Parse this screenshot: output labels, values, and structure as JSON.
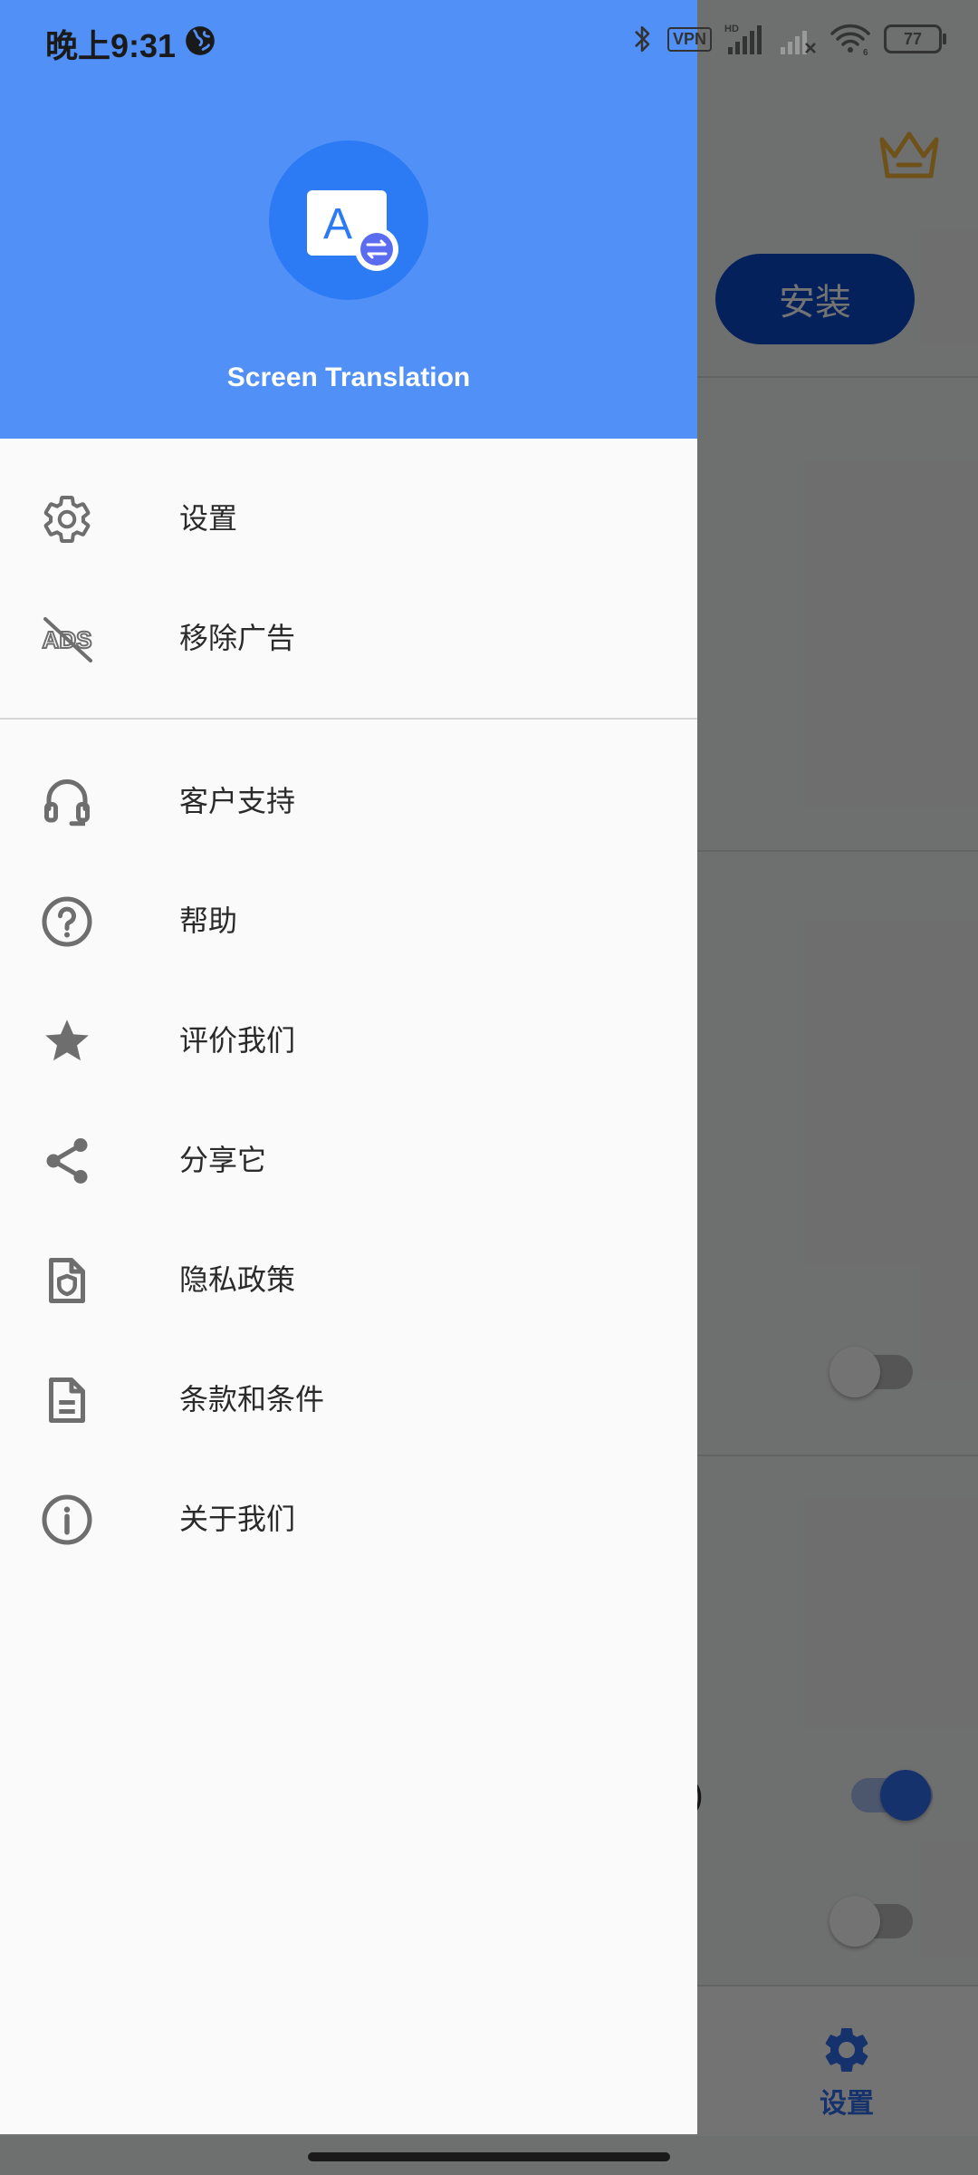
{
  "status_bar": {
    "time": "晚上9:31",
    "vpn": "VPN",
    "hd": "HD",
    "battery": "77",
    "wifi_sub": "6"
  },
  "drawer": {
    "app_name": "Screen Translation",
    "logo_letter": "A",
    "menu_primary": [
      {
        "label": "设置",
        "icon": "gear-icon"
      },
      {
        "label": "移除广告",
        "icon": "ads-off-icon"
      }
    ],
    "menu_secondary": [
      {
        "label": "客户支持",
        "icon": "headset-icon"
      },
      {
        "label": "帮助",
        "icon": "help-circle-icon"
      },
      {
        "label": "评价我们",
        "icon": "star-icon"
      },
      {
        "label": "分享它",
        "icon": "share-icon"
      },
      {
        "label": "隐私政策",
        "icon": "privacy-doc-icon"
      },
      {
        "label": "条款和条件",
        "icon": "document-icon"
      },
      {
        "label": "关于我们",
        "icon": "info-icon"
      }
    ]
  },
  "background": {
    "install_label": "安装",
    "paren_fragment": ")",
    "bottom_nav_settings_label": "设置"
  },
  "colors": {
    "header_blue": "#5190f7",
    "accent_blue": "#2f6ff0",
    "crown_gold": "#f5b53a"
  }
}
